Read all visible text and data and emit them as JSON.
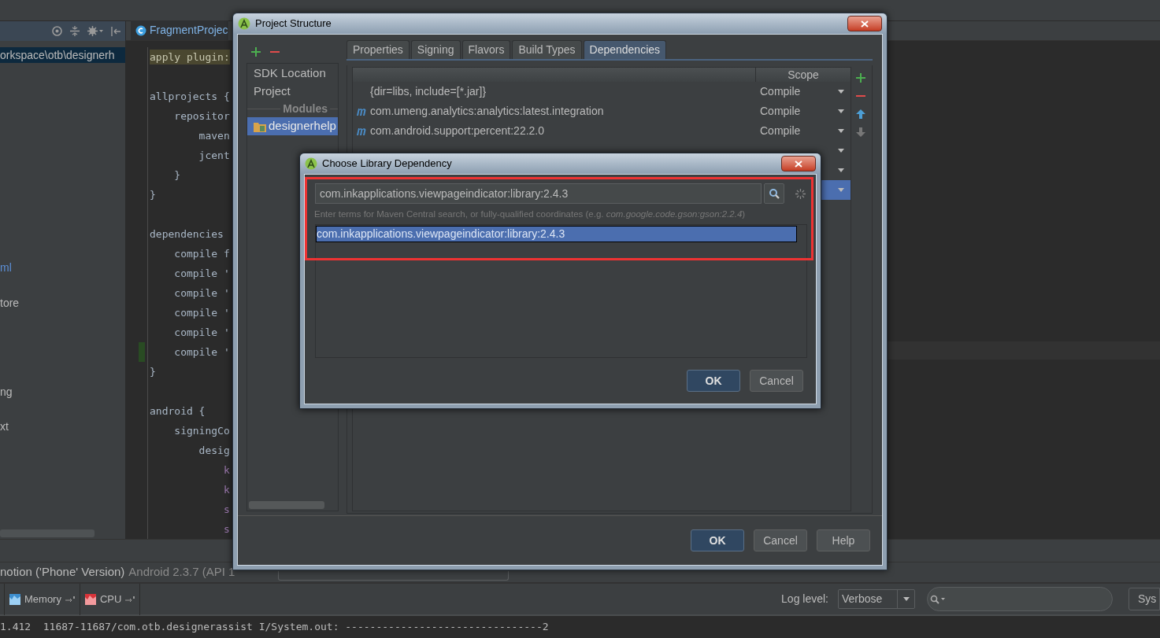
{
  "project_panel": {
    "items": [
      {
        "label": "orkspace\\otb\\designerh",
        "selected": true,
        "kind": "path"
      },
      {
        "label": "ml",
        "selected": false,
        "kind": "link"
      },
      {
        "label": "tore",
        "selected": false,
        "kind": "plain"
      },
      {
        "label": "ng",
        "selected": false,
        "kind": "plain"
      },
      {
        "label": "xt",
        "selected": false,
        "kind": "plain"
      }
    ]
  },
  "editor": {
    "tab": "FragmentProjec",
    "lines": [
      {
        "text": "apply plugin:",
        "kind": "highlight"
      },
      {
        "kind": "blank"
      },
      {
        "text": "allprojects {",
        "kind": "code"
      },
      {
        "text": "    repositor",
        "kind": "code"
      },
      {
        "text": "        maven",
        "kind": "code"
      },
      {
        "text": "        jcent",
        "kind": "code"
      },
      {
        "text": "    }",
        "kind": "code"
      },
      {
        "text": "}",
        "kind": "code"
      },
      {
        "kind": "blank"
      },
      {
        "text": "dependencies",
        "kind": "code"
      },
      {
        "text": "    compile f",
        "kind": "code"
      },
      {
        "text": "    compile '",
        "kind": "code"
      },
      {
        "text": "    compile '",
        "kind": "code"
      },
      {
        "text": "    compile '",
        "kind": "code"
      },
      {
        "text": "    compile '",
        "kind": "code"
      },
      {
        "text": "    compile '",
        "kind": "changed"
      },
      {
        "text": "}",
        "kind": "code"
      },
      {
        "kind": "blank"
      },
      {
        "text": "android {",
        "kind": "code"
      },
      {
        "text": "    signingCo",
        "kind": "code"
      },
      {
        "text": "        desig",
        "kind": "code"
      },
      {
        "text": "            k",
        "kind": "field"
      },
      {
        "text": "            k",
        "kind": "field"
      },
      {
        "text": "            s",
        "kind": "field"
      },
      {
        "text": "            s",
        "kind": "field"
      }
    ]
  },
  "device_bar": {
    "device": "notion ('Phone' Version)",
    "api": "Android 2.3.7 (API 1"
  },
  "monitor_tabs": [
    "Memory",
    "CPU"
  ],
  "log_level": {
    "label": "Log level:",
    "value": "Verbose"
  },
  "sys_button": "Sys",
  "log_line": "1.412  11687-11687/com.otb.designerassist I/System.out: --------------------------------2",
  "project_structure": {
    "title": "Project Structure",
    "side_items": [
      {
        "label": "SDK Location",
        "kind": "item",
        "selected": false
      },
      {
        "label": "Project",
        "kind": "item",
        "selected": false
      },
      {
        "label": "Modules",
        "kind": "header",
        "selected": false
      },
      {
        "label": "designerhelp",
        "kind": "module",
        "selected": true
      }
    ],
    "tabs": [
      {
        "label": "Properties",
        "selected": false
      },
      {
        "label": "Signing",
        "selected": false
      },
      {
        "label": "Flavors",
        "selected": false
      },
      {
        "label": "Build Types",
        "selected": false
      },
      {
        "label": "Dependencies",
        "selected": true
      }
    ],
    "scope_header": "Scope",
    "rows": [
      {
        "name": "{dir=libs, include=[*.jar]}",
        "maven": false,
        "scope": "Compile",
        "selected": false,
        "kind": "row"
      },
      {
        "name": "com.umeng.analytics:analytics:latest.integration",
        "maven": true,
        "scope": "Compile",
        "selected": false,
        "kind": "row"
      },
      {
        "name": "com.android.support:percent:22.2.0",
        "maven": true,
        "scope": "Compile",
        "selected": false,
        "kind": "row"
      },
      {
        "selected": false,
        "kind": "covered"
      },
      {
        "selected": false,
        "kind": "covered"
      },
      {
        "selected": true,
        "kind": "covered"
      }
    ],
    "buttons": [
      {
        "label": "OK",
        "default": true
      },
      {
        "label": "Cancel",
        "default": false
      },
      {
        "label": "Help",
        "default": false
      }
    ]
  },
  "choose_dialog": {
    "title": "Choose Library Dependency",
    "search_value": "com.inkapplications.viewpageindicator:library:2.4.3",
    "hint": "Enter terms for Maven Central search, or fully-qualified coordinates (e.g. *com.google.code.gson:gson:2.2.4*)",
    "results": [
      {
        "label": "com.inkapplications.viewpageindicator:library:2.4.3",
        "selected": true
      }
    ],
    "buttons": [
      {
        "label": "OK",
        "default": true
      },
      {
        "label": "Cancel",
        "default": false
      }
    ]
  }
}
